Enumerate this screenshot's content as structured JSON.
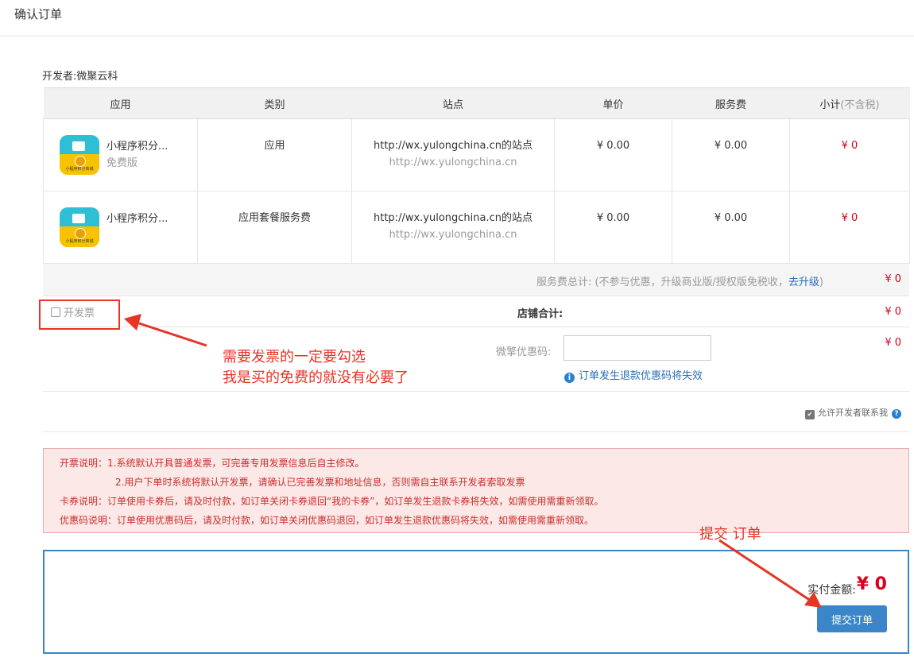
{
  "page": {
    "title": "确认订单"
  },
  "developer": "开发者:微聚云科",
  "table": {
    "headers": [
      "应用",
      "类别",
      "站点",
      "单价",
      "服务费"
    ],
    "subtotal_header": "小计",
    "subtotal_note": "(不含税)",
    "icon_caption": "小程序积分商城",
    "rows": [
      {
        "name": "小程序积分...",
        "edition": "免费版",
        "category": "应用",
        "site_name": "http://wx.yulongchina.cn的站点",
        "site_url": "http://wx.yulongchina.cn",
        "unit_price": "¥ 0.00",
        "service_fee": "¥ 0.00",
        "subtotal": "¥ 0"
      },
      {
        "name": "小程序积分...",
        "edition": "",
        "category": "应用套餐服务费",
        "site_name": "http://wx.yulongchina.cn的站点",
        "site_url": "http://wx.yulongchina.cn",
        "unit_price": "¥ 0.00",
        "service_fee": "¥ 0.00",
        "subtotal": "¥ 0"
      }
    ]
  },
  "fees": {
    "label_prefix": "服务费总计:  (不参与优惠，升级商业版/授权版免税收，",
    "upgrade_link": "去升级",
    "label_suffix": ")",
    "value": "¥ 0"
  },
  "shop": {
    "invoice_label": "开发票",
    "total_label": "店铺合计:",
    "total_value": "¥ 0"
  },
  "coupon": {
    "label": "微擎优惠码:",
    "input_value": "",
    "hint": "订单发生退款优惠码将失效",
    "info_icon": "i",
    "value": "¥ 0"
  },
  "contact": {
    "check_mark": "✔",
    "label": "允许开发者联系我",
    "help_icon": "?"
  },
  "notes": {
    "lines": [
      "开票说明：1.系统默认开具普通发票，可完善专用发票信息后自主修改。",
      "2.用户下单时系统将默认开发票，请确认已完善发票和地址信息，否则需自主联系开发者索取发票",
      "卡券说明：订单使用卡券后，请及时付款，如订单关闭卡券退回“我的卡券”，如订单发生退款卡券将失效，如需使用需重新领取。",
      "优惠码说明：订单使用优惠码后，请及时付款，如订单关闭优惠码退回，如订单发生退款优惠码将失效，如需使用需重新领取。"
    ]
  },
  "payment": {
    "label": "实付金额:",
    "amount": "¥ 0",
    "submit_label": "提交订单"
  },
  "annotations": {
    "invoice_line1": "需要发票的一定要勾选",
    "invoice_line2": "我是买的免费的就没有必要了",
    "submit_note": "提交 订单"
  },
  "colors": {
    "accent": "#3a86c8",
    "price_red": "#d9001b",
    "annotation_red": "#e63425",
    "notice_bg": "#fde8e8"
  }
}
